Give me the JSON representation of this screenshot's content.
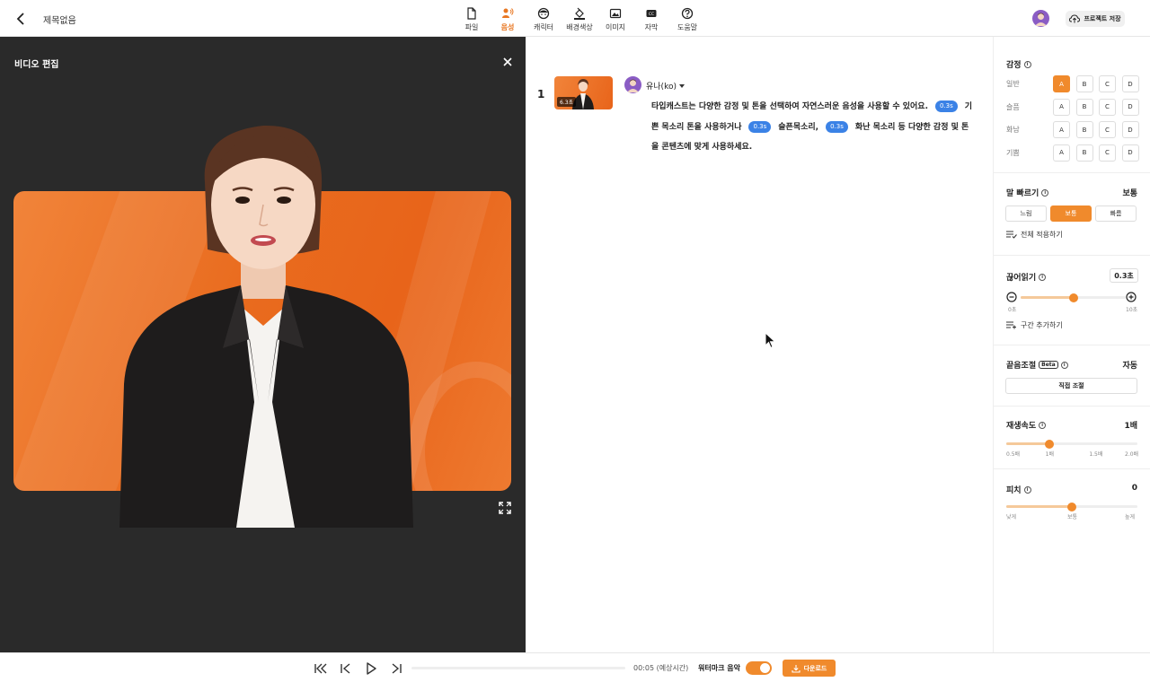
{
  "header": {
    "title": "제목없음",
    "tools": [
      {
        "label": "파일",
        "icon": "file-icon"
      },
      {
        "label": "음성",
        "icon": "voice-icon",
        "active": true
      },
      {
        "label": "캐릭터",
        "icon": "character-icon"
      },
      {
        "label": "배경색상",
        "icon": "paint-bucket-icon"
      },
      {
        "label": "이미지",
        "icon": "image-icon"
      },
      {
        "label": "자막",
        "icon": "caption-icon"
      },
      {
        "label": "도움말",
        "icon": "help-icon"
      }
    ],
    "save_label": "프로젝트 저장"
  },
  "preview": {
    "title": "비디오 편집"
  },
  "script": {
    "scene_number": "1",
    "scene_duration": "6.3초",
    "voice_name": "유나(ko)",
    "segments": [
      "타입캐스트는 다양한 감정 및 톤을 선택하여 자연스러운 음성을 사용할 수 있어요.",
      "기쁜 목소리 톤을 사용하거나",
      "슬픈목소리,",
      "화난 목소리 등 다양한 감정 및 톤을 콘텐츠에 맞게 사용하세요."
    ],
    "pauses": [
      "0.3s",
      "0.3s",
      "0.3s"
    ]
  },
  "settings": {
    "emotion": {
      "title": "감정",
      "rows": [
        {
          "name": "일반",
          "active": "A"
        },
        {
          "name": "슬픔",
          "active": ""
        },
        {
          "name": "화남",
          "active": ""
        },
        {
          "name": "기쁨",
          "active": ""
        }
      ],
      "options": [
        "A",
        "B",
        "C",
        "D"
      ]
    },
    "speed": {
      "title": "말 빠르기",
      "value": "보통",
      "options": [
        "느림",
        "보통",
        "빠름"
      ],
      "active": "보통",
      "apply_all": "전체 적용하기"
    },
    "pause": {
      "title": "끊어읽기",
      "value": "0.3초",
      "min_label": "0초",
      "max_label": "10초",
      "fraction": 0.5,
      "add_label": "구간 추가하기"
    },
    "end_tone": {
      "title": "끝음조절",
      "badge": "Beta",
      "value": "자동",
      "button": "직접 조절"
    },
    "playback": {
      "title": "재생속도",
      "value": "1배",
      "ticks": [
        "0.5배",
        "1배",
        "1.5배",
        "2.0배"
      ],
      "fraction": 0.33
    },
    "pitch": {
      "title": "피치",
      "value": "0",
      "ticks": [
        "낮게",
        "보통",
        "높게"
      ],
      "fraction": 0.5
    }
  },
  "player": {
    "time": "00:05 (예상시간)",
    "watermark_label": "워터마크 음악",
    "watermark_on": true,
    "download_label": "다운로드"
  },
  "colors": {
    "accent": "#f08a2c",
    "pause_chip": "#3b82e6",
    "preview_bg": "#2a2a2a"
  }
}
